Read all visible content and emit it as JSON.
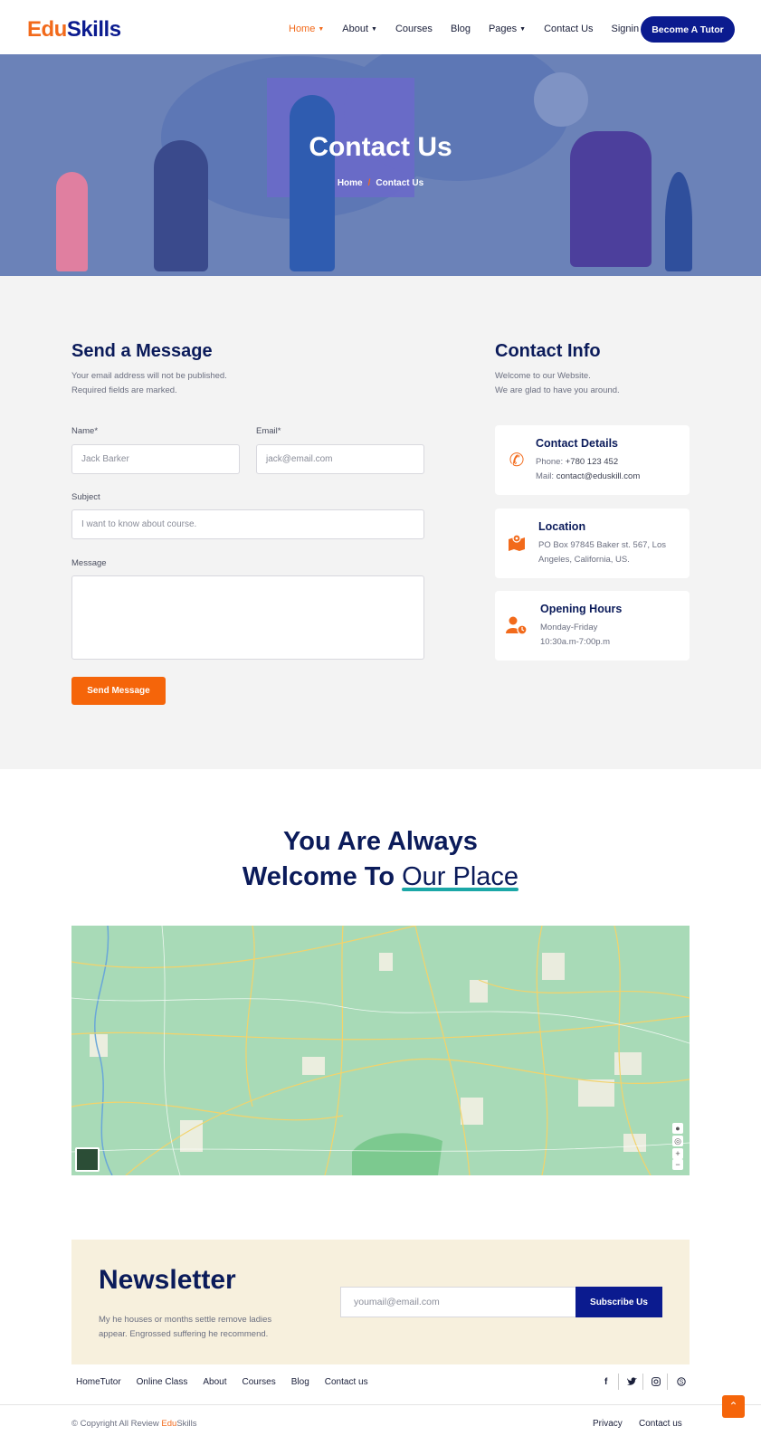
{
  "brand": {
    "part1": "Edu",
    "part2": "Skills"
  },
  "nav": {
    "items": [
      "Home",
      "About",
      "Courses",
      "Blog",
      "Pages",
      "Contact Us",
      "Signin"
    ],
    "cta": "Become A Tutor"
  },
  "hero": {
    "title": "Contact Us",
    "crumb_home": "Home",
    "crumb_sep": "/",
    "crumb_current": "Contact Us"
  },
  "form": {
    "title": "Send a Message",
    "note1": "Your email address will not be published.",
    "note2": "Required fields are marked.",
    "name_label": "Name*",
    "name_placeholder": "Jack Barker",
    "email_label": "Email*",
    "email_placeholder": "jack@email.com",
    "subject_label": "Subject",
    "subject_placeholder": "I want to know about course.",
    "message_label": "Message",
    "send_label": "Send Message"
  },
  "info": {
    "title": "Contact Info",
    "note1": "Welcome to our Website.",
    "note2": "We are glad to have you around.",
    "cards": [
      {
        "title": "Contact Details",
        "line1_label": "Phone: ",
        "line1_value": "+780 123 452",
        "line2_label": "Mail: ",
        "line2_value": "contact@eduskill.com",
        "icon": "phone-icon"
      },
      {
        "title": "Location",
        "line1": "PO Box 97845 Baker st. 567, Los",
        "line2": "Angeles, California, US.",
        "icon": "map-marker-icon"
      },
      {
        "title": "Opening Hours",
        "line1": "Monday-Friday",
        "line2": "10:30a.m-7:00p.m",
        "icon": "user-clock-icon"
      }
    ]
  },
  "welcome": {
    "line1": "You Are Always",
    "line2a": "Welcome To",
    "line2b": "Our Place"
  },
  "newsletter": {
    "title": "Newsletter",
    "text": "My he houses or months settle remove ladies appear. Engrossed suffering he recommend.",
    "placeholder": "youmail@email.com",
    "button": "Subscribe Us"
  },
  "footer": {
    "links": [
      "HomeTutor",
      "Online Class",
      "About",
      "Courses",
      "Blog",
      "Contact us"
    ],
    "copyright_prefix": "© Copyright All Review ",
    "bottom_links": [
      "Privacy",
      "Contact us"
    ]
  },
  "colors": {
    "accent": "#f26a1b",
    "brand_blue": "#0b1b8f",
    "heading": "#0b1b5a",
    "teal": "#1ba7a7"
  }
}
